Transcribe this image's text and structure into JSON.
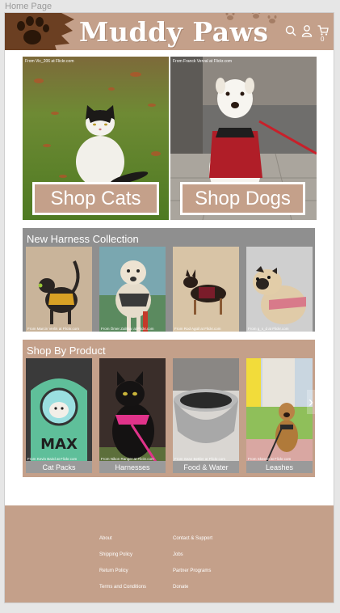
{
  "page_label": "Home Page",
  "header": {
    "logo": "Muddy Paws",
    "cart_count": "0"
  },
  "hero": [
    {
      "credit": "From Vic_206 at Flickr.com",
      "button": "Shop Cats"
    },
    {
      "credit": "From Franck Verval at Flickr.com",
      "button": "Shop Dogs"
    }
  ],
  "harness": {
    "title": "New Harness Collection",
    "items": [
      {
        "credit": "From Marcin Verlik at Flickr.com"
      },
      {
        "credit": "From Ömer Zalitkar at Flickr.com"
      },
      {
        "credit": "From Rod Agüil at Flickr.com"
      },
      {
        "credit": "From g_s_d at Flickr.com"
      }
    ]
  },
  "products": {
    "title": "Shop By Product",
    "items": [
      {
        "label": "Cat Packs",
        "credit": "From Kevin Baird at Flickr.com"
      },
      {
        "label": "Harnesses",
        "credit": "From Nikon Ranger at Flickr.com"
      },
      {
        "label": "Food & Water",
        "credit": "From Sean Bettler at Flickr.com"
      },
      {
        "label": "Leashes",
        "credit": "From Skeeze at Flickr.com"
      }
    ]
  },
  "footer": {
    "left": [
      "About",
      "Shipping Policy",
      "Return Policy",
      "Terms and Conditions"
    ],
    "right": [
      "Contact & Support",
      "Jobs",
      "Partner Programs",
      "Donate"
    ]
  },
  "colors": {
    "brand": "#c4a08a",
    "section_gray": "#8f8f8f"
  }
}
